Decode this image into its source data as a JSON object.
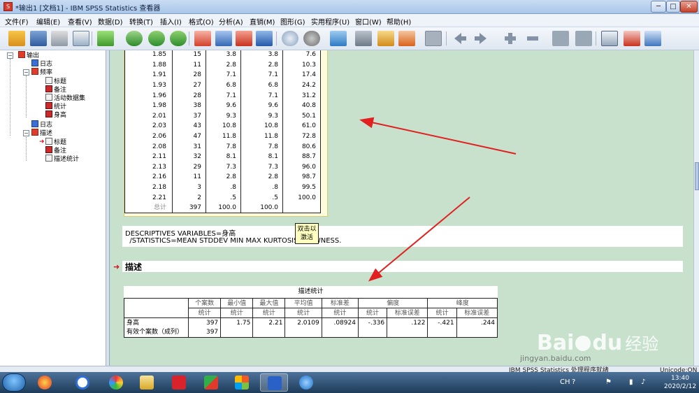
{
  "window": {
    "title": "*输出1 [文档1] - IBM SPSS Statistics 查看器",
    "minimize": "─",
    "maximize": "□",
    "close": "✕"
  },
  "menu": [
    "文件(F)",
    "编辑(E)",
    "查看(V)",
    "数据(D)",
    "转换(T)",
    "插入(I)",
    "格式(O)",
    "分析(A)",
    "直销(M)",
    "图形(G)",
    "实用程序(U)",
    "窗口(W)",
    "帮助(H)"
  ],
  "tree": {
    "root": "输出",
    "log1": "日志",
    "freq": "频率",
    "freq_title": "标题",
    "freq_notes": "备注",
    "freq_dataset": "活动数据集",
    "freq_stats": "统计",
    "freq_height": "身高",
    "log2": "日志",
    "desc": "描述",
    "desc_title": "标题",
    "desc_notes": "备注",
    "desc_stats": "描述统计"
  },
  "freq_table": {
    "rows": [
      [
        "1.85",
        "15",
        "3.8",
        "3.8",
        "7.6"
      ],
      [
        "1.88",
        "11",
        "2.8",
        "2.8",
        "10.3"
      ],
      [
        "1.91",
        "28",
        "7.1",
        "7.1",
        "17.4"
      ],
      [
        "1.93",
        "27",
        "6.8",
        "6.8",
        "24.2"
      ],
      [
        "1.96",
        "28",
        "7.1",
        "7.1",
        "31.2"
      ],
      [
        "1.98",
        "38",
        "9.6",
        "9.6",
        "40.8"
      ],
      [
        "2.01",
        "37",
        "9.3",
        "9.3",
        "50.1"
      ],
      [
        "2.03",
        "43",
        "10.8",
        "10.8",
        "61.0"
      ],
      [
        "2.06",
        "47",
        "11.8",
        "11.8",
        "72.8"
      ],
      [
        "2.08",
        "31",
        "7.8",
        "7.8",
        "80.6"
      ],
      [
        "2.11",
        "32",
        "8.1",
        "8.1",
        "88.7"
      ],
      [
        "2.13",
        "29",
        "7.3",
        "7.3",
        "96.0"
      ],
      [
        "2.16",
        "11",
        "2.8",
        "2.8",
        "98.7"
      ],
      [
        "2.18",
        "3",
        ".8",
        ".8",
        "99.5"
      ],
      [
        "2.21",
        "2",
        ".5",
        ".5",
        "100.0"
      ]
    ],
    "total": [
      "总计",
      "397",
      "100.0",
      "100.0",
      ""
    ]
  },
  "syntax": {
    "line1": "DESCRIPTIVES VARIABLES=身高",
    "line2": "  /STATISTICS=MEAN STDDEV MIN MAX KURTOSIS SKEWNESS."
  },
  "tooltip": {
    "line1": "双击以",
    "line2": "激活"
  },
  "section_heading": "描述",
  "desc_table": {
    "title": "描述统计",
    "headers": [
      "个案数",
      "最小值",
      "最大值",
      "平均值",
      "标准差",
      "偏度",
      "峰度"
    ],
    "subheaders": [
      "统计",
      "统计",
      "统计",
      "统计",
      "统计",
      "统计",
      "标准误差",
      "统计",
      "标准误差"
    ],
    "rows": [
      {
        "label": "身高",
        "values": [
          "397",
          "1.75",
          "2.21",
          "2.0109",
          ".08924",
          "-.336",
          ".122",
          "-.421",
          ".244"
        ]
      },
      {
        "label": "有效个案数（成列）",
        "values": [
          "397",
          "",
          "",
          "",
          "",
          "",
          "",
          "",
          ""
        ]
      }
    ]
  },
  "statusbar": {
    "processor": "IBM SPSS Statistics 处理程序就绪",
    "unicode": "Unicode:ON"
  },
  "taskbar": {
    "time": "13:40",
    "date": "2020/2/12",
    "lang": "CH"
  },
  "watermark": {
    "brand": "Bai",
    "brand2": "du",
    "suffix": "经验",
    "url": "jingyan.baidu.com"
  }
}
